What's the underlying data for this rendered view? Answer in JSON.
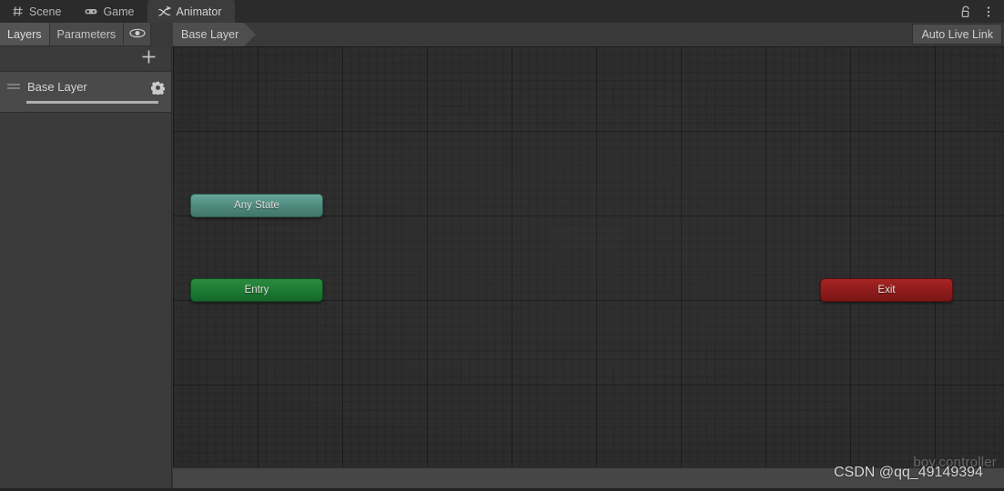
{
  "window": {
    "tabs": [
      {
        "label": "Scene",
        "icon": "grid-icon",
        "active": false
      },
      {
        "label": "Game",
        "icon": "gamepad-icon",
        "active": false
      },
      {
        "label": "Animator",
        "icon": "animator-node-icon",
        "active": true
      }
    ],
    "lock_icon": "unlocked-padlock-icon",
    "menu_icon": "kebab-menu-icon"
  },
  "toolbar": {
    "layers_tab": "Layers",
    "parameters_tab": "Parameters",
    "eye_icon": "eye-icon",
    "breadcrumb": "Base Layer",
    "auto_live_link": "Auto Live Link"
  },
  "sidebar": {
    "add_layer_icon": "plus-icon",
    "layers": [
      {
        "name": "Base Layer",
        "drag_handle_icon": "drag-handle-icon",
        "settings_icon": "gear-icon",
        "weight": "1"
      }
    ]
  },
  "canvas": {
    "nodes": [
      {
        "label": "Any State",
        "type": "any-state",
        "color": "#4f8a7e"
      },
      {
        "label": "Entry",
        "type": "entry",
        "color": "#1d7a33"
      },
      {
        "label": "Exit",
        "type": "exit",
        "color": "#8f1c1c"
      }
    ],
    "asset_label": "boy.controller"
  },
  "watermark": "CSDN @qq_49149394"
}
